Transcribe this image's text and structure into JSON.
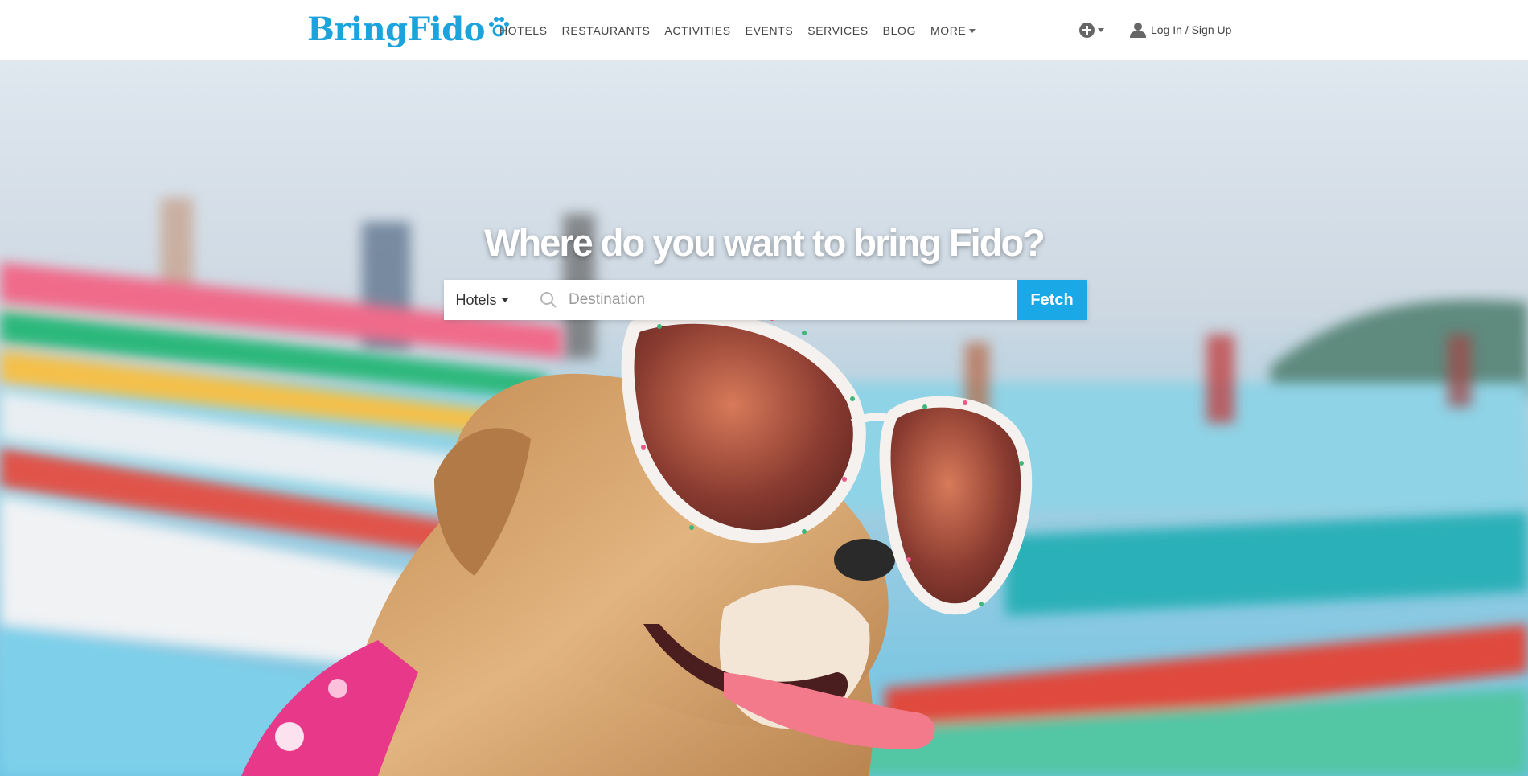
{
  "brand": {
    "name": "BringFido",
    "color": "#1aa3dc"
  },
  "nav": {
    "items": [
      {
        "label": "HOTELS"
      },
      {
        "label": "RESTAURANTS"
      },
      {
        "label": "ACTIVITIES"
      },
      {
        "label": "EVENTS"
      },
      {
        "label": "SERVICES"
      },
      {
        "label": "BLOG"
      },
      {
        "label": "MORE"
      }
    ],
    "more_has_dropdown": true
  },
  "header_actions": {
    "add_icon": "plus-circle-icon",
    "login_label": "Log In / Sign Up",
    "login_icon": "user-icon"
  },
  "hero": {
    "headline": "Where do you want to bring Fido?",
    "image_description_icon": "hero-image"
  },
  "search": {
    "type_selected": "Hotels",
    "destination_placeholder": "Destination",
    "destination_value": "",
    "submit_label": "Fetch",
    "accent": "#1aa9e6"
  }
}
